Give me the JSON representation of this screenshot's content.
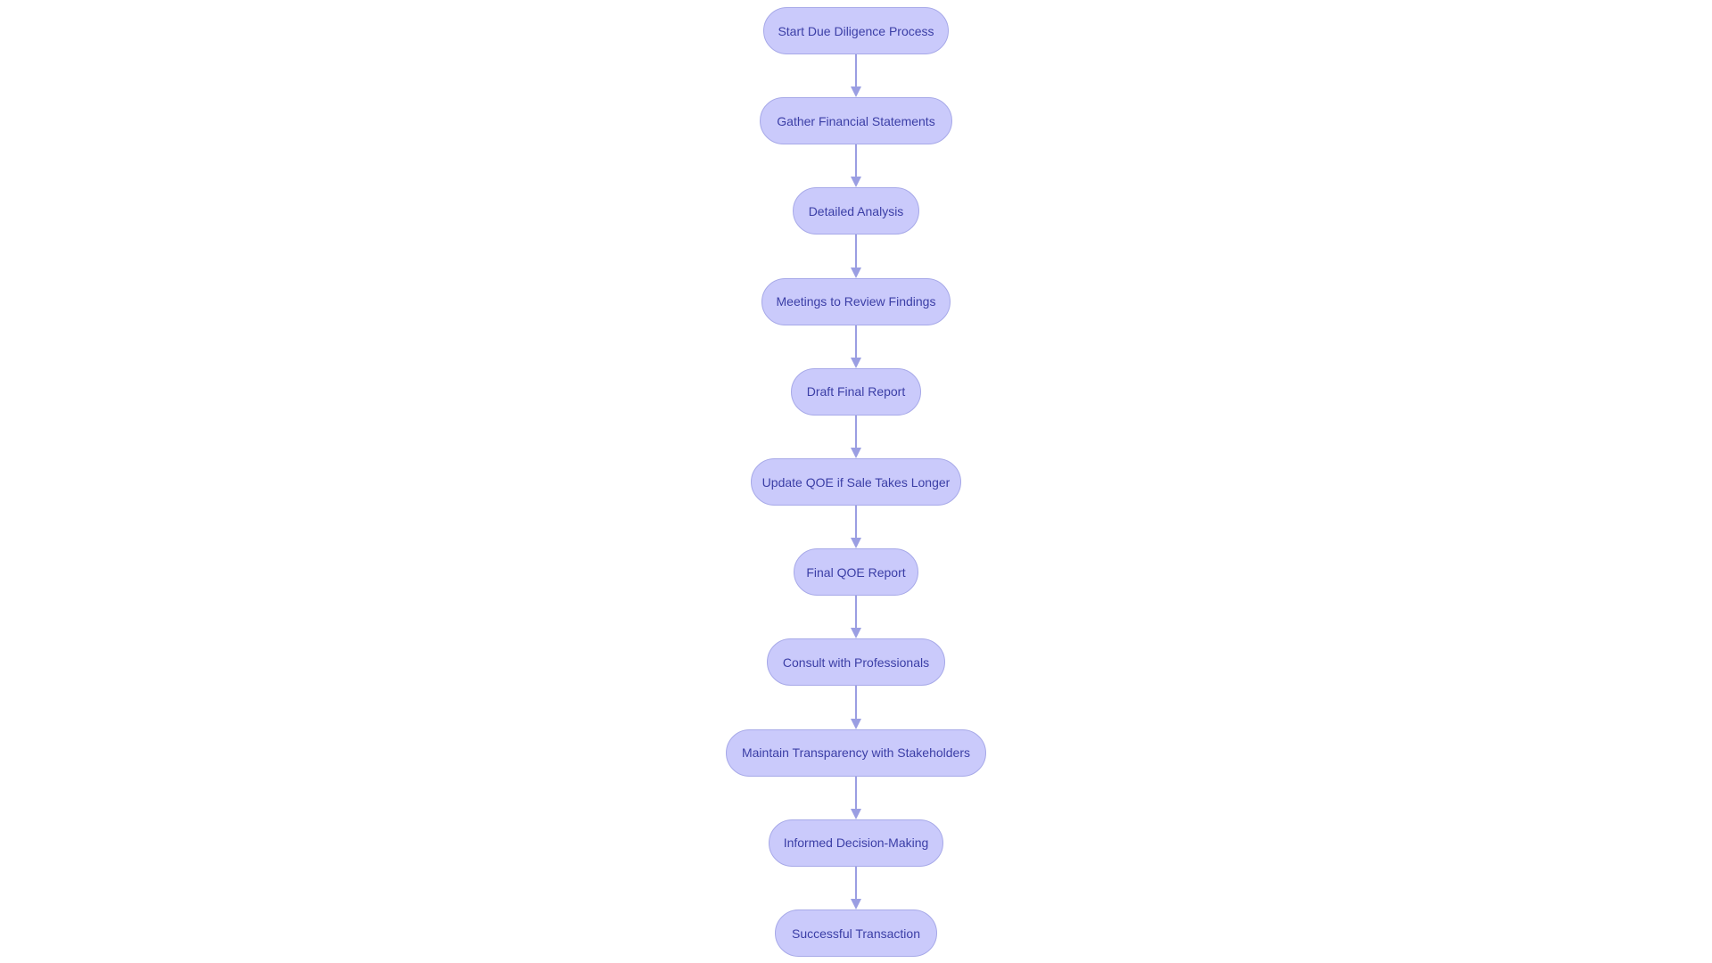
{
  "diagram": {
    "type": "flowchart",
    "direction": "top-to-bottom",
    "colors": {
      "node_fill": "#cacafb",
      "node_border": "#a7a9e8",
      "node_text": "#3b3ea6",
      "edge": "#9a9ee2",
      "background": "#ffffff"
    },
    "nodes": [
      {
        "id": "start",
        "label": "Start Due Diligence Process"
      },
      {
        "id": "gather",
        "label": "Gather Financial Statements"
      },
      {
        "id": "analysis",
        "label": "Detailed Analysis"
      },
      {
        "id": "meetings",
        "label": "Meetings to Review Findings"
      },
      {
        "id": "draft",
        "label": "Draft Final Report"
      },
      {
        "id": "update",
        "label": "Update QOE if Sale Takes Longer"
      },
      {
        "id": "final",
        "label": "Final QOE Report"
      },
      {
        "id": "consult",
        "label": "Consult with Professionals"
      },
      {
        "id": "transparency",
        "label": "Maintain Transparency with Stakeholders"
      },
      {
        "id": "decision",
        "label": "Informed Decision-Making"
      },
      {
        "id": "success",
        "label": "Successful Transaction"
      }
    ],
    "edges": [
      {
        "from": "start",
        "to": "gather"
      },
      {
        "from": "gather",
        "to": "analysis"
      },
      {
        "from": "analysis",
        "to": "meetings"
      },
      {
        "from": "meetings",
        "to": "draft"
      },
      {
        "from": "draft",
        "to": "update"
      },
      {
        "from": "update",
        "to": "final"
      },
      {
        "from": "final",
        "to": "consult"
      },
      {
        "from": "consult",
        "to": "transparency"
      },
      {
        "from": "transparency",
        "to": "decision"
      },
      {
        "from": "decision",
        "to": "success"
      }
    ]
  }
}
